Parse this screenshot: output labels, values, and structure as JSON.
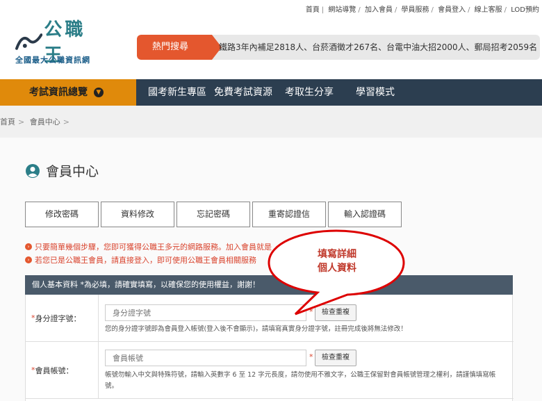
{
  "top_links": [
    "首頁",
    "網站導覽",
    "加入會員",
    "學員服務",
    "會員登入",
    "線上客服",
    "LOD預約"
  ],
  "logo": {
    "main": "公職王",
    "sub": "全國最大公職資訊網"
  },
  "hot": {
    "label": "熱門搜尋",
    "text": "鐵路3年內補足2818人、台菸酒徵才267名、台電中油大招2000人、郵局招考2059名"
  },
  "nav": {
    "main": "考試資訊總覽",
    "items": [
      "國考新生專區",
      "免費考試資源",
      "考取生分享",
      "學習模式"
    ]
  },
  "breadcrumb": [
    "首頁",
    "會員中心"
  ],
  "page_title": "會員中心",
  "tabs": [
    "修改密碼",
    "資料修改",
    "忘記密碼",
    "重寄認證信",
    "輸入認證碼"
  ],
  "notes": [
    "只要簡單幾個步驟，您即可獲得公職王多元的網路服務。加入會員就是",
    "若您已是公職王會員，請直接登入，即可使用公職王會員相關服務"
  ],
  "callout": {
    "line1": "填寫詳細",
    "line2": "個人資料"
  },
  "form": {
    "header": "個人基本資料 *為必填，請確實填寫，以確保您的使用權益，謝謝！",
    "id_field": {
      "label": "身分證字號：",
      "placeholder": "身分證字號",
      "check_button": "檢查重複",
      "hint": "您的身分證字號即為會員登入帳號(登入後不會顯示)，請填寫真實身分證字號，註冊完成後將無法修改！"
    },
    "account_field": {
      "label": "會員帳號：",
      "placeholder": "會員帳號",
      "check_button": "檢查重複",
      "hint": "帳號勿輸入中文與特殊符號，請輸入英數字 6 至 12 字元長度，請勿使用不雅文字，公職王保留對會員帳號管理之權利，請謹慎填寫帳號。"
    }
  },
  "colors": {
    "accent": "#e4572e",
    "nav_bg": "#2c3e50",
    "nav_main": "#e08a0b",
    "brand": "#2b7e88"
  }
}
